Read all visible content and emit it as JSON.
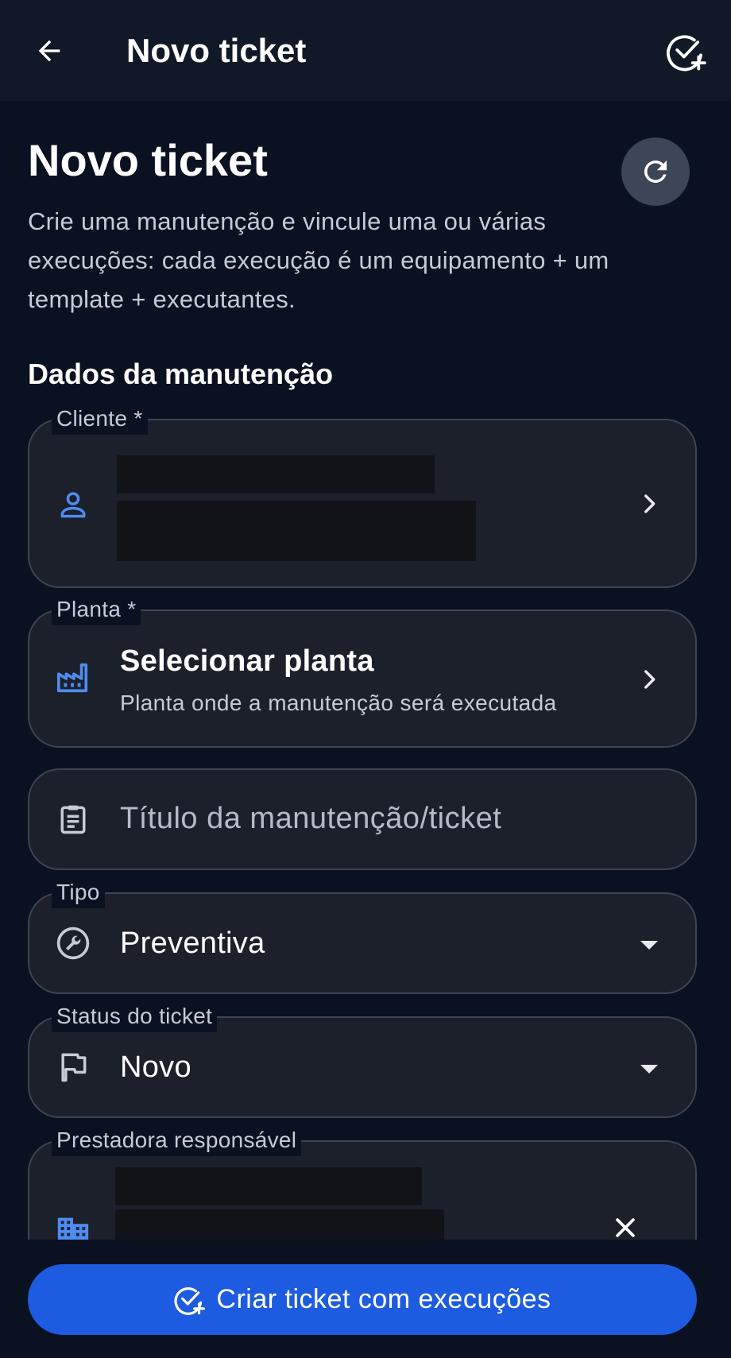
{
  "appbar": {
    "title": "Novo ticket"
  },
  "header": {
    "title": "Novo ticket",
    "description": "Crie uma manutenção e vincule uma ou várias execuções: cada execução é um equipamento + um template + executantes."
  },
  "section": {
    "title": "Dados da manutenção"
  },
  "fields": {
    "cliente": {
      "label": "Cliente *"
    },
    "planta": {
      "label": "Planta *",
      "value": "Selecionar planta",
      "hint": "Planta onde a manutenção será executada"
    },
    "titulo": {
      "placeholder": "Título da manutenção/ticket"
    },
    "tipo": {
      "label": "Tipo",
      "value": "Preventiva"
    },
    "status": {
      "label": "Status do ticket",
      "value": "Novo"
    },
    "prestadora": {
      "label": "Prestadora responsável"
    }
  },
  "cta": {
    "label": "Criar ticket com execuções"
  },
  "colors": {
    "background": "#0a1120",
    "surface": "#1b202b",
    "accent_icon": "#4e8cf0",
    "primary_button": "#1d5be0"
  },
  "icons": {
    "back": "arrow-left-icon",
    "appbar_action": "check-circle-plus-icon",
    "refresh": "refresh-icon",
    "cliente": "person-icon",
    "planta": "factory-icon",
    "titulo": "clipboard-icon",
    "tipo": "wrench-icon",
    "status": "flag-icon",
    "prestadora": "building-icon"
  }
}
